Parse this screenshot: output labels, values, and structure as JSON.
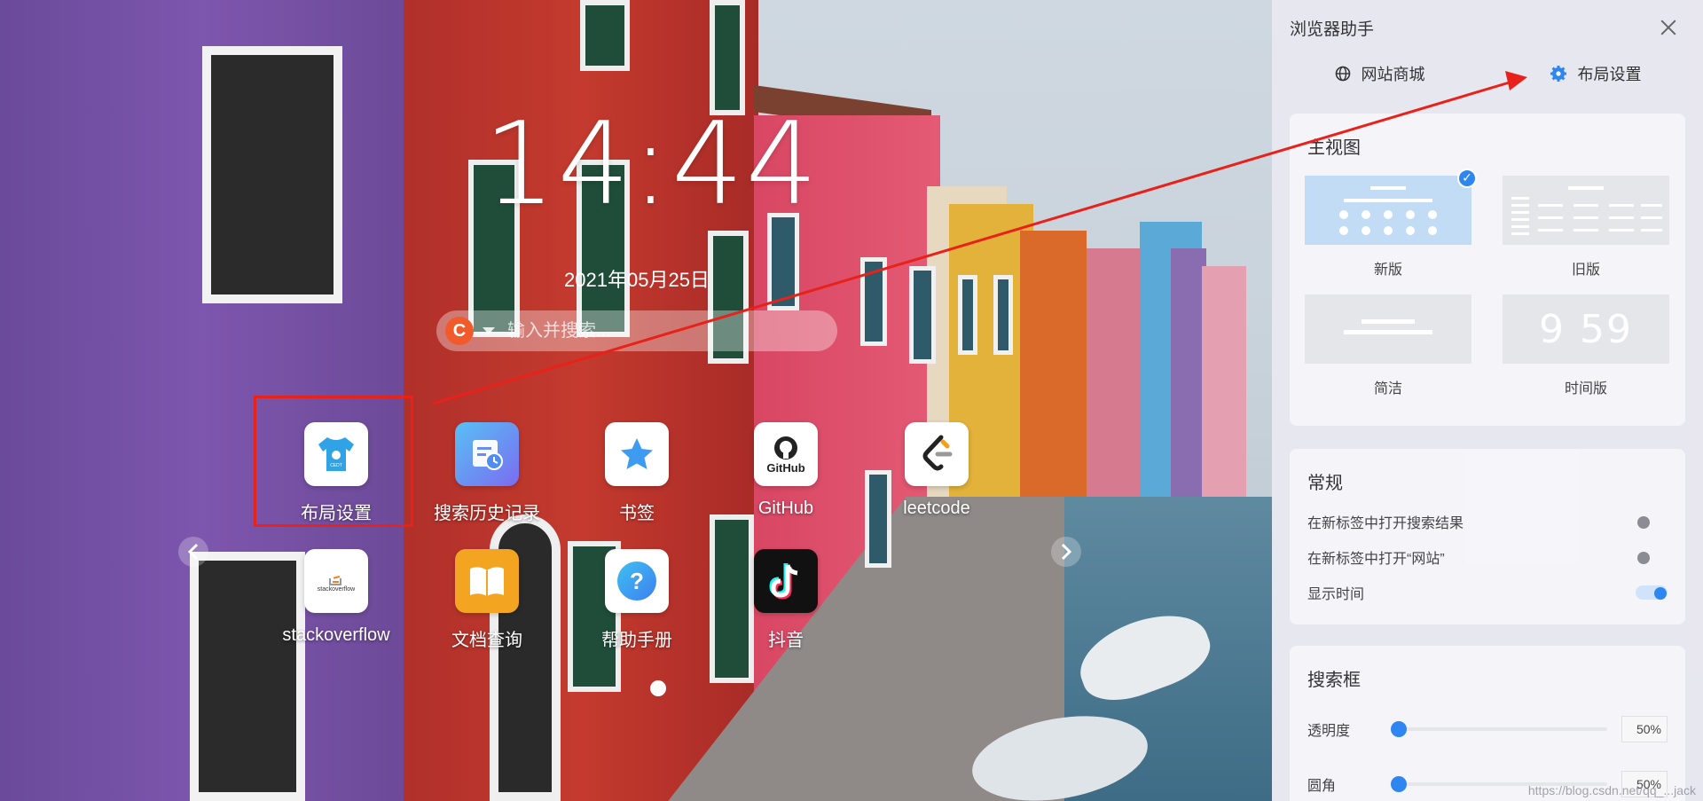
{
  "clock": {
    "time": "14:44",
    "date": "2021年05月25日"
  },
  "search": {
    "engine_letter": "C",
    "placeholder": "输入并搜索..."
  },
  "apps": [
    {
      "label": "布局设置",
      "icon": "shirt-icon"
    },
    {
      "label": "搜索历史记录",
      "icon": "history-icon"
    },
    {
      "label": "书签",
      "icon": "star-icon"
    },
    {
      "label": "GitHub",
      "icon": "github-icon",
      "tile_text": "GitHub"
    },
    {
      "label": "leetcode",
      "icon": "leetcode-icon"
    },
    {
      "label": "stackoverflow",
      "icon": "stackoverflow-icon",
      "tile_text": "stackoverflow"
    },
    {
      "label": "文档查询",
      "icon": "book-icon"
    },
    {
      "label": "帮助手册",
      "icon": "help-icon",
      "tile_text": "?"
    },
    {
      "label": "抖音",
      "icon": "tiktok-icon"
    }
  ],
  "shirt_badge": "CEDT",
  "panel": {
    "title": "浏览器助手",
    "tabs": [
      {
        "label": "网站商城",
        "icon": "globe-icon"
      },
      {
        "label": "布局设置",
        "icon": "gear-icon"
      }
    ],
    "main_view": {
      "title": "主视图",
      "options": [
        {
          "label": "新版",
          "selected": true
        },
        {
          "label": "旧版",
          "selected": false
        },
        {
          "label": "简洁",
          "selected": false
        },
        {
          "label": "时间版",
          "selected": false,
          "preview": "9 59"
        }
      ]
    },
    "general": {
      "title": "常规",
      "rows": [
        {
          "label": "在新标签中打开搜索结果",
          "on": false
        },
        {
          "label": "在新标签中打开“网站”",
          "on": false
        },
        {
          "label": "显示时间",
          "on": true
        }
      ]
    },
    "search_box": {
      "title": "搜索框",
      "sliders": [
        {
          "label": "透明度",
          "value": "50%",
          "level": 0
        },
        {
          "label": "圆角",
          "value": "50%",
          "level": 0
        }
      ]
    }
  },
  "watermark": "https://blog.csdn.net/qq_...jack",
  "colors": {
    "accent": "#2e86f0",
    "highlight": "#e8211a"
  }
}
